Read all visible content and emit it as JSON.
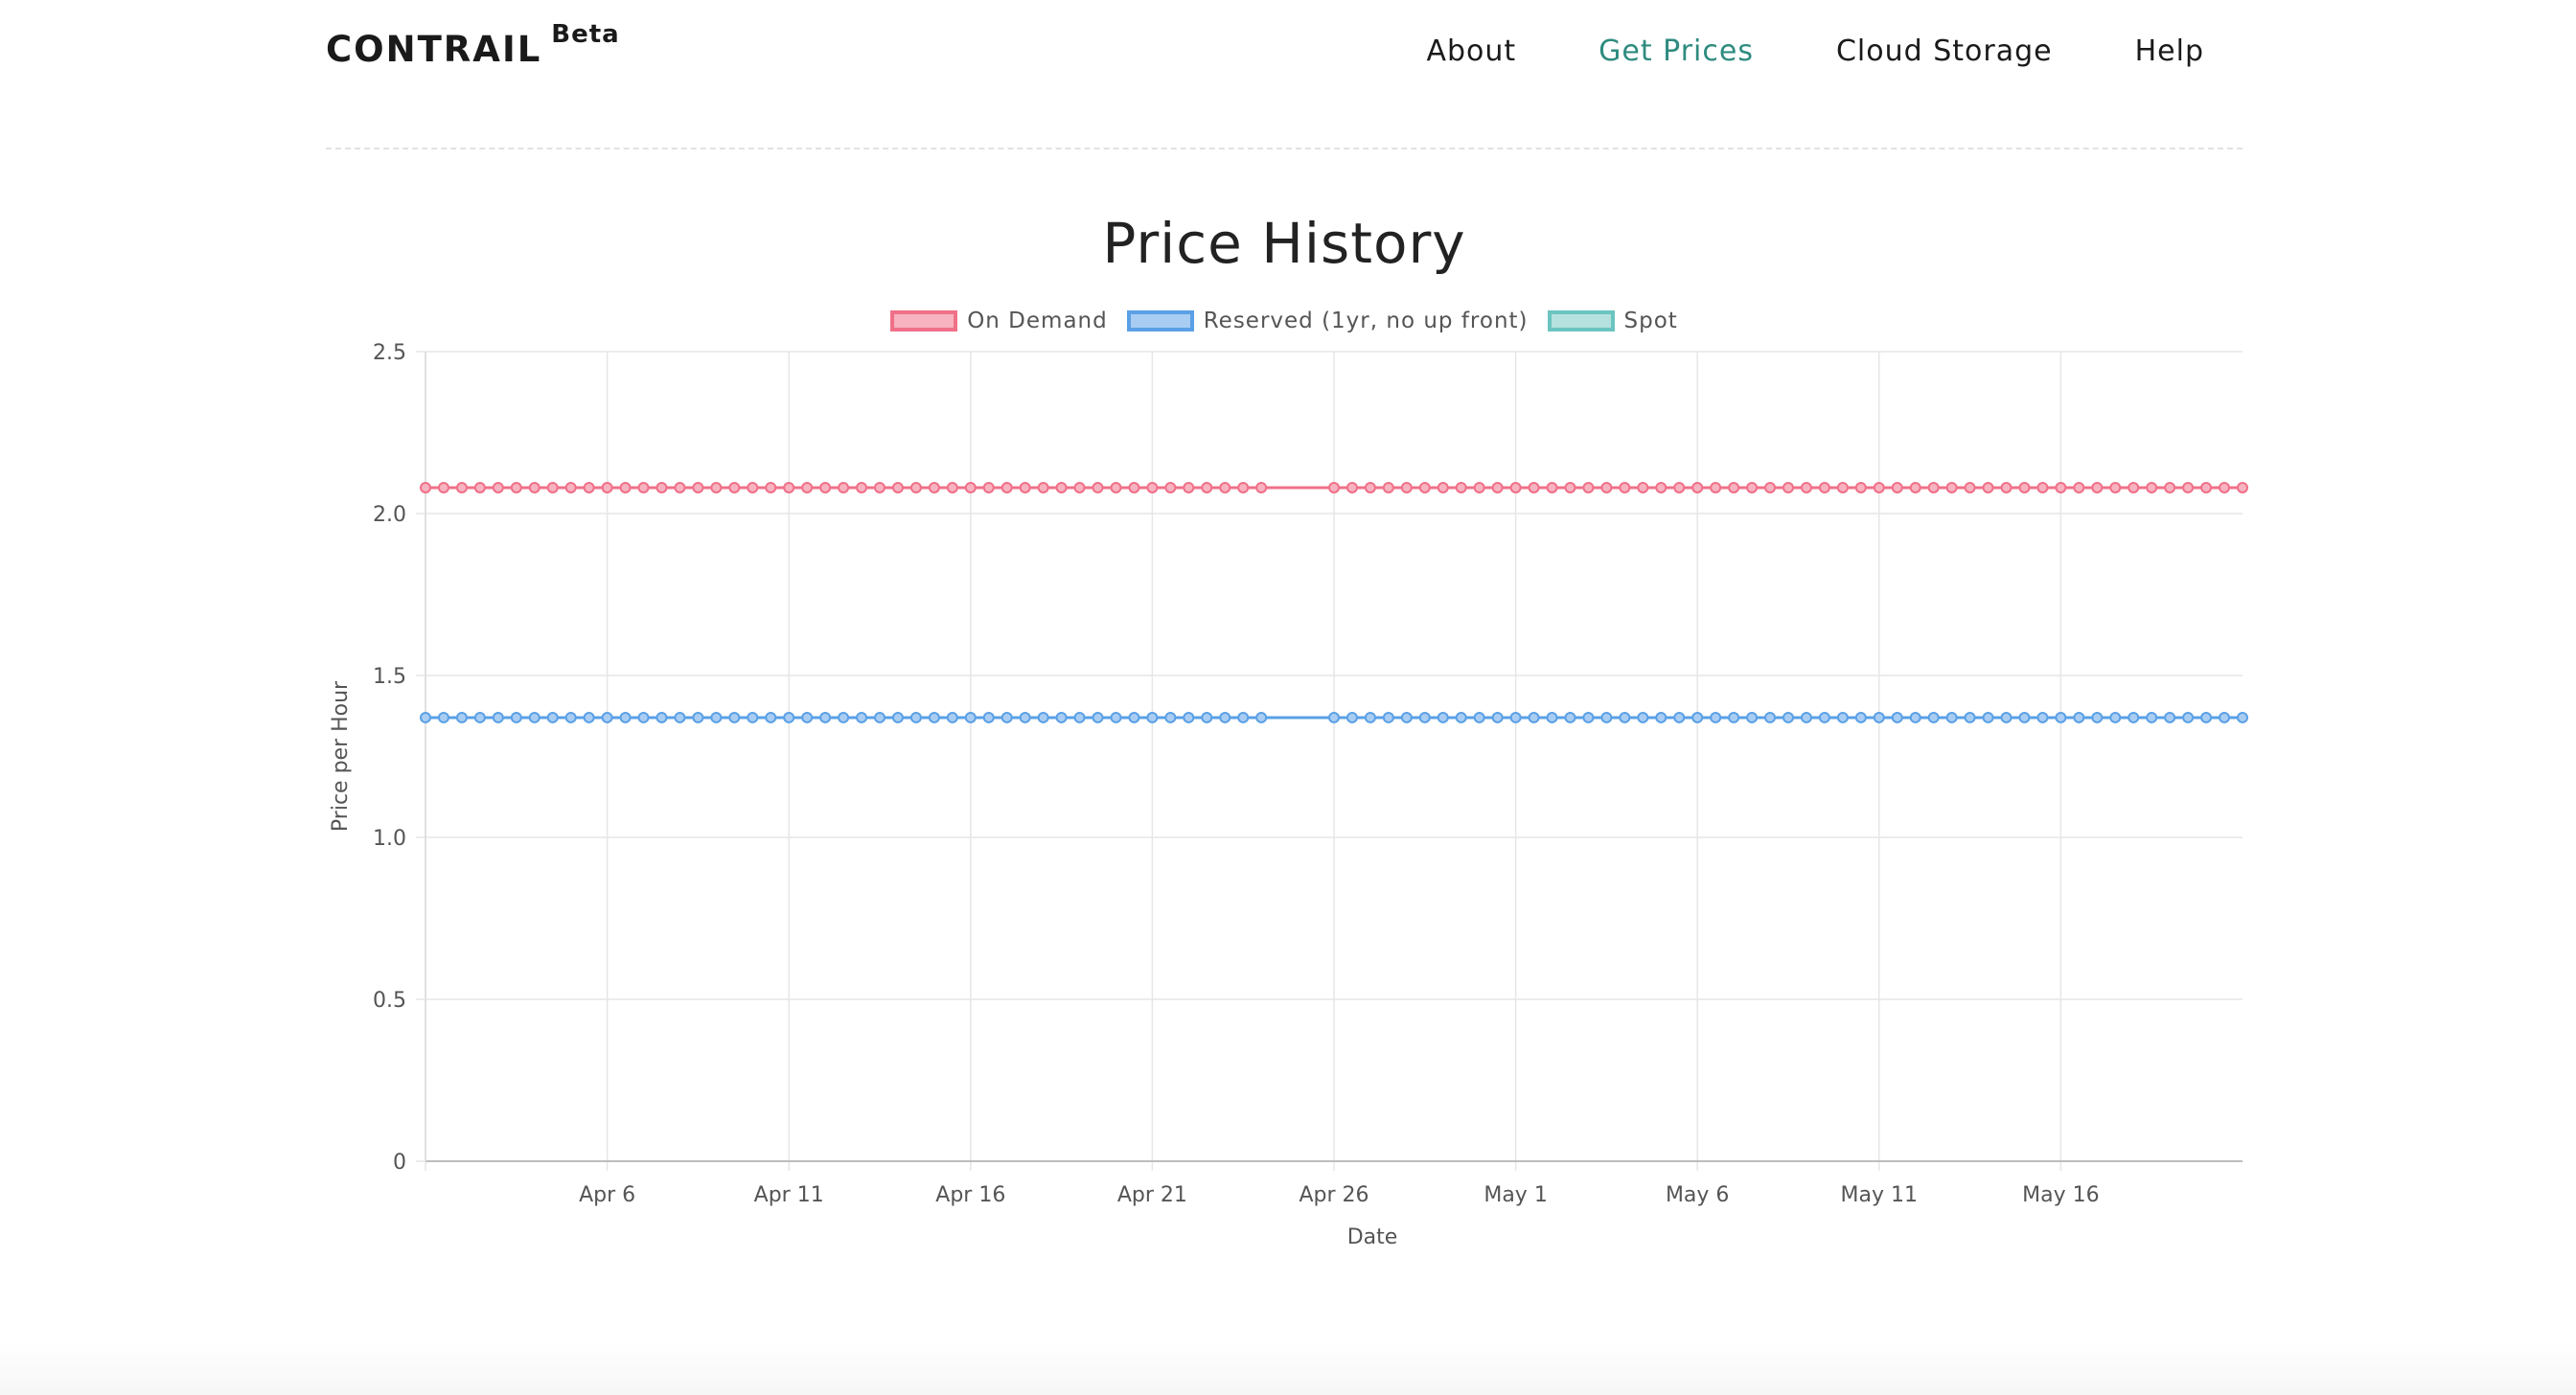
{
  "header": {
    "brand": "CONTRAIL",
    "brand_badge": "Beta",
    "nav": [
      {
        "label": "About",
        "active": false
      },
      {
        "label": "Get Prices",
        "active": true
      },
      {
        "label": "Cloud Storage",
        "active": false
      },
      {
        "label": "Help",
        "active": false
      }
    ]
  },
  "colors": {
    "nav_active": "#2e8b7f",
    "on_demand": "#f07088",
    "reserved": "#5aa0e6",
    "spot": "#6cc4c0"
  },
  "chart_data": {
    "type": "line",
    "title": "Price History",
    "xlabel": "Date",
    "ylabel": "Price per Hour",
    "ylim": [
      0,
      2.5
    ],
    "yticks": [
      "0",
      "0.5",
      "1.0",
      "1.5",
      "2.0",
      "2.5"
    ],
    "x_range": [
      "Apr 1",
      "May 21"
    ],
    "xticks": [
      "Apr 6",
      "Apr 11",
      "Apr 16",
      "Apr 21",
      "Apr 26",
      "May 1",
      "May 6",
      "May 11",
      "May 16"
    ],
    "grid": true,
    "legend_position": "top-center",
    "series": [
      {
        "name": "On Demand",
        "color": "#f07088",
        "fill": "#f7b3c0",
        "value": 2.08,
        "points_per_day": 2,
        "gap": [
          "Apr 24",
          "Apr 26"
        ]
      },
      {
        "name": "Reserved (1yr, no up front)",
        "color": "#5aa0e6",
        "fill": "#a9cdf2",
        "value": 1.37,
        "points_per_day": 2,
        "gap": [
          "Apr 24",
          "Apr 26"
        ]
      },
      {
        "name": "Spot",
        "color": "#6cc4c0",
        "fill": "#b5e2df",
        "value": null,
        "points_per_day": 0,
        "gap": null
      }
    ]
  }
}
